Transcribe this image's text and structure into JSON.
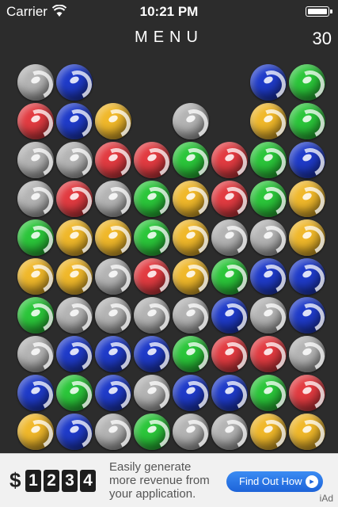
{
  "status_bar": {
    "carrier": "Carrier",
    "time": "10:21 PM"
  },
  "header": {
    "menu_label": "MENU",
    "score": "30"
  },
  "colors": {
    "gray": "#b4b4b4",
    "blue": "#1f3bc9",
    "green": "#2bc63a",
    "red": "#e23b41",
    "yellow": "#f0b82a"
  },
  "board": {
    "rows": [
      [
        "gray",
        "blue",
        null,
        null,
        null,
        null,
        "blue",
        "green"
      ],
      [
        "red",
        "blue",
        "yellow",
        null,
        "gray",
        null,
        "yellow",
        "green"
      ],
      [
        "gray",
        "gray",
        "red",
        "red",
        "green",
        "red",
        "green",
        "blue"
      ],
      [
        "gray",
        "red",
        "gray",
        "green",
        "yellow",
        "red",
        "green",
        "yellow"
      ],
      [
        "green",
        "yellow",
        "yellow",
        "green",
        "yellow",
        "gray",
        "gray",
        "yellow"
      ],
      [
        "yellow",
        "yellow",
        "gray",
        "red",
        "yellow",
        "green",
        "blue",
        "blue"
      ],
      [
        "green",
        "gray",
        "gray",
        "gray",
        "gray",
        "blue",
        "gray",
        "blue"
      ],
      [
        "gray",
        "blue",
        "blue",
        "blue",
        "green",
        "red",
        "red",
        "gray"
      ],
      [
        "blue",
        "green",
        "blue",
        "gray",
        "blue",
        "blue",
        "green",
        "red"
      ],
      [
        "yellow",
        "blue",
        "gray",
        "green",
        "gray",
        "gray",
        "yellow",
        "yellow"
      ]
    ]
  },
  "ad": {
    "dollar": "$",
    "digits": [
      "1",
      "2",
      "3",
      "4"
    ],
    "line1": "Easily generate",
    "line2": "more revenue from",
    "line3": "your application.",
    "button_label": "Find Out How",
    "brand": "iAd"
  }
}
